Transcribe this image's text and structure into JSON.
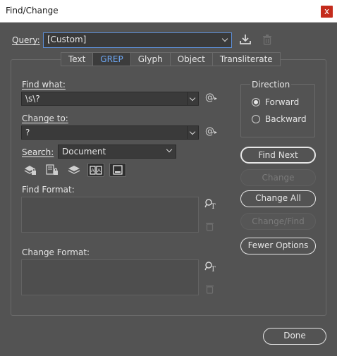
{
  "window": {
    "title": "Find/Change",
    "close_glyph": "x"
  },
  "query": {
    "label": "Query:",
    "value": "[Custom]"
  },
  "tabs": [
    {
      "label": "Text"
    },
    {
      "label": "GREP"
    },
    {
      "label": "Glyph"
    },
    {
      "label": "Object"
    },
    {
      "label": "Transliterate"
    }
  ],
  "find_what": {
    "label": "Find what:",
    "value": "\\s\\?"
  },
  "change_to": {
    "label": "Change to:",
    "value": "?"
  },
  "special_char_glyph": "@",
  "search": {
    "label": "Search:",
    "value": "Document"
  },
  "find_format": {
    "label": "Find Format:"
  },
  "change_format": {
    "label": "Change Format:"
  },
  "direction": {
    "label": "Direction",
    "options": [
      {
        "label": "Forward",
        "selected": true
      },
      {
        "label": "Backward",
        "selected": false
      }
    ]
  },
  "buttons": {
    "find_next": "Find Next",
    "change": "Change",
    "change_all": "Change All",
    "change_find": "Change/Find",
    "fewer_options": "Fewer Options",
    "done": "Done"
  },
  "colors": {
    "background": "#535353",
    "accent": "#6ea8f5",
    "close": "#c42b1c"
  }
}
